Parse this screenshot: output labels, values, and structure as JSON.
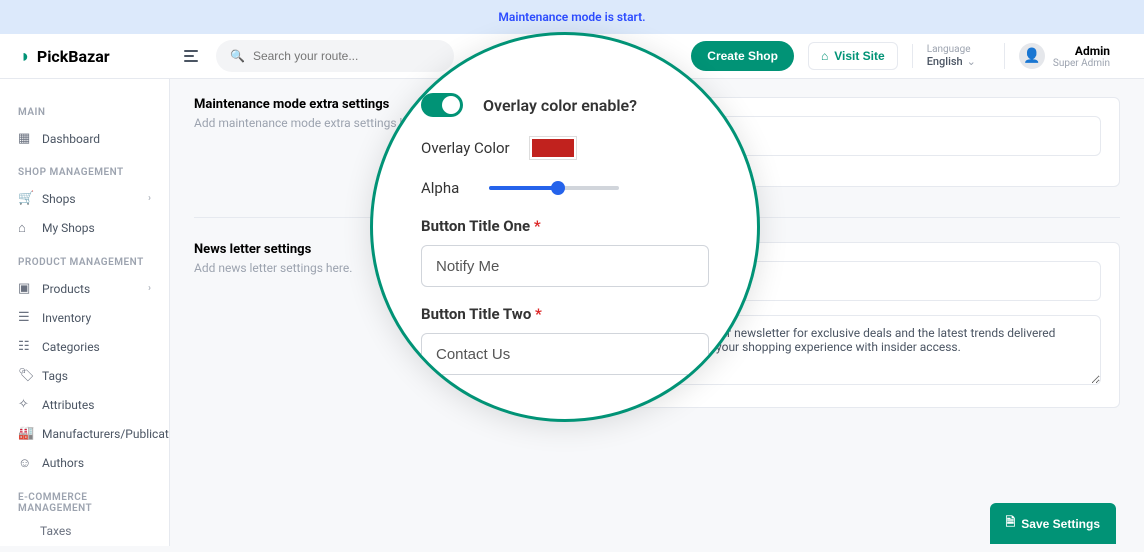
{
  "banner": {
    "text": "Maintenance mode is start."
  },
  "brand": {
    "name": "PickBazar"
  },
  "header": {
    "search_placeholder": "Search your route...",
    "create_label": "Create Shop",
    "visit_label": "Visit Site",
    "lang_label": "Language",
    "lang_value": "English",
    "user_name": "Admin",
    "user_role": "Super Admin"
  },
  "sidebar": {
    "sections": {
      "main": "MAIN",
      "shop": "SHOP MANAGEMENT",
      "product": "PRODUCT MANAGEMENT",
      "ecom": "E-COMMERCE MANAGEMENT"
    },
    "items": {
      "dashboard": "Dashboard",
      "shops": "Shops",
      "my_shops": "My Shops",
      "products": "Products",
      "inventory": "Inventory",
      "categories": "Categories",
      "tags": "Tags",
      "attributes": "Attributes",
      "manufacturers": "Manufacturers/Publications",
      "authors": "Authors",
      "taxes": "Taxes"
    }
  },
  "sections": {
    "maintenance": {
      "title": "Maintenance mode extra settings",
      "sub": "Add maintenance mode extra settings here."
    },
    "newsletter": {
      "title": "News letter settings",
      "sub": "Add news letter settings here."
    }
  },
  "newsletter": {
    "textarea_value": "Stay in the loop! Subscribe to our newsletter for exclusive deals and the latest trends delivered straight to your inbox. Elevate your shopping experience with insider access."
  },
  "magnifier": {
    "overlay_enable_label": "Overlay color enable?",
    "overlay_color_label": "Overlay Color",
    "overlay_color_value": "#c1221e",
    "alpha_label": "Alpha",
    "alpha_value": 52,
    "btn1_label": "Button Title One",
    "btn1_value": "Notify Me",
    "btn2_label": "Button Title Two",
    "btn2_value": "Contact Us"
  },
  "footer": {
    "save": "Save Settings"
  }
}
